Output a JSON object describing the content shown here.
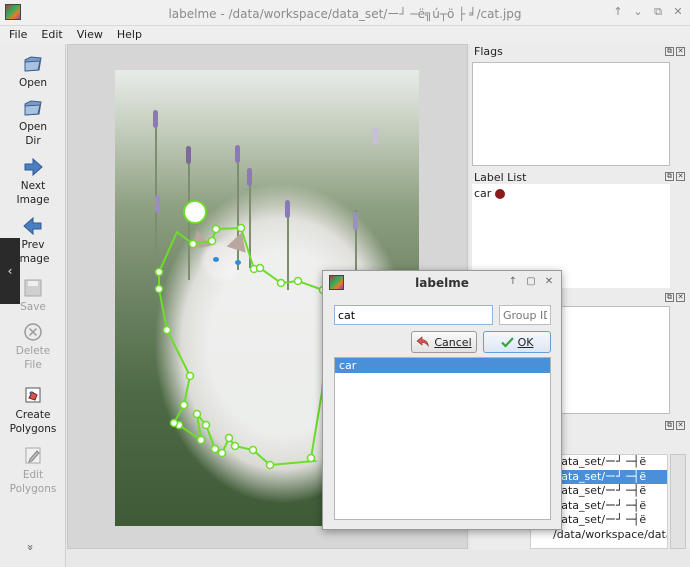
{
  "window": {
    "title": "labelme - /data/workspace/data_set/ー┘ ─ë╗ú┬ö ├ ╛/cat.jpg",
    "controls": [
      "↑",
      "⌄",
      "⧉",
      "✕"
    ]
  },
  "menu": {
    "file": "File",
    "edit": "Edit",
    "view": "View",
    "help": "Help"
  },
  "toolbar": {
    "open": "Open",
    "open_dir": "Open\nDir",
    "next_image": "Next\nImage",
    "prev_image": "Prev\nImage",
    "save": "Save",
    "delete_file": "Delete\nFile",
    "create_polygons": "Create\nPolygons",
    "edit_polygons": "Edit\nPolygons",
    "more": "»"
  },
  "canvas": {
    "left_tab": "‹",
    "right_tab": "›"
  },
  "docks": {
    "flags": {
      "title": "Flags"
    },
    "label_list": {
      "title": "Label List",
      "items": [
        {
          "label": "car",
          "color": "#8b1a1a"
        }
      ]
    },
    "file_list": {
      "rows": [
        "ace/data_set/ー┘ ─┤ë",
        "ace/data_set/ー┘ ─┤ë",
        "ace/data_set/ー┘ ─┤ë",
        "ace/data_set/ー┘ ─┤ë",
        "ace/data_set/ー┘ ─┤ë",
        "/data/workspace/data_set/ー┘ ─┤ë"
      ],
      "selected_index": 1
    }
  },
  "dialog": {
    "title": "labelme",
    "label_value": "cat",
    "group_id_placeholder": "Group ID",
    "cancel_label": "Cancel",
    "ok_label": "OK",
    "labels": [
      "car"
    ],
    "selected_index": 0
  },
  "colors": {
    "polygon": "#6ddc2a",
    "selection": "#4a90d9",
    "label_car": "#8b1a1a"
  }
}
